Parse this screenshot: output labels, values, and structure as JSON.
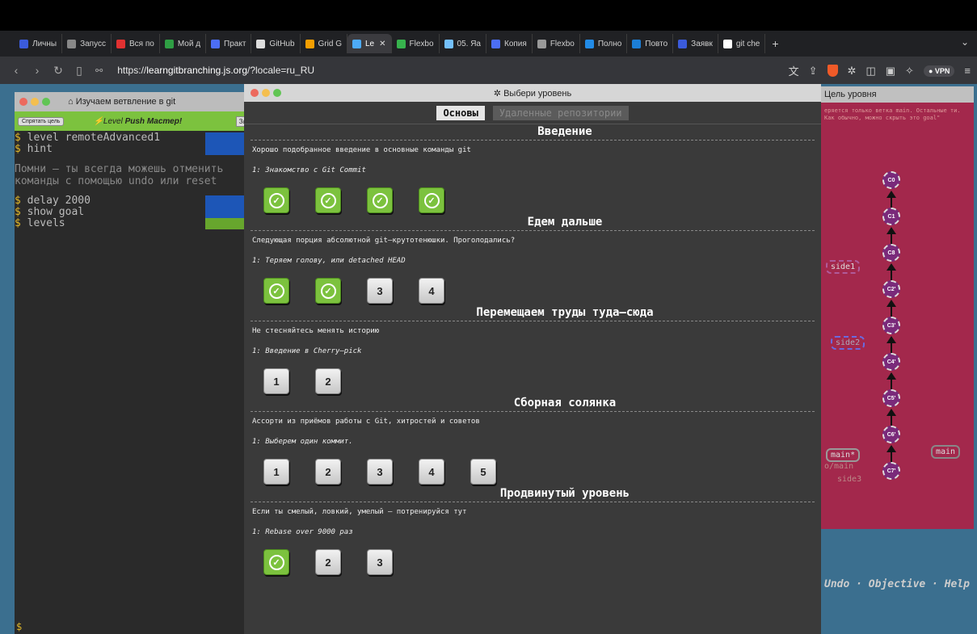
{
  "browser": {
    "tabs": [
      {
        "label": "Личны",
        "color": "#3b5bdb"
      },
      {
        "label": "Запусс",
        "color": "#888888"
      },
      {
        "label": "Вся по",
        "color": "#e03131"
      },
      {
        "label": "Мой д",
        "color": "#2f9e44"
      },
      {
        "label": "Практ",
        "color": "#4c6ef5"
      },
      {
        "label": "GitHub",
        "color": "#dddddd"
      },
      {
        "label": "Grid G",
        "color": "#f59f00"
      },
      {
        "label": "Le",
        "color": "#4dabf7",
        "active": true
      },
      {
        "label": "Flexbo",
        "color": "#37b24d"
      },
      {
        "label": "05. Яа",
        "color": "#74c0fc"
      },
      {
        "label": "Копия",
        "color": "#4c6ef5"
      },
      {
        "label": "Flexbo",
        "color": "#999999"
      },
      {
        "label": "Полно",
        "color": "#228be6"
      },
      {
        "label": "Повто",
        "color": "#1c7ed6"
      },
      {
        "label": "Заявк",
        "color": "#3b5bdb"
      },
      {
        "label": "git che",
        "color": "#ffffff"
      }
    ],
    "url_prefix": "https://",
    "url_host": "learngitbranching.js.org",
    "url_path": "/?locale=ru_RU",
    "vpn_label": "VPN"
  },
  "terminal": {
    "title": "Изучаем ветвление в git",
    "hide_goal": "Спрятать цель",
    "level_label": "Level",
    "level_name": "Push Мастер!",
    "task_label": "Зада",
    "lines": [
      "level remoteAdvanced1",
      "hint"
    ],
    "hint": "Помни – ты всегда можешь отменить команды с помощью undo или reset",
    "lines2": [
      "delay 2000",
      "show goal",
      "levels"
    ],
    "prompt": "$"
  },
  "goal": {
    "title": "Цель уровня",
    "desc": "еряется только ветка main. Остальные ти. Как обычно, можно скрыть это goal\"",
    "commits": [
      "C0",
      "C1",
      "C8",
      "C2'",
      "C3'",
      "C4'",
      "C5'",
      "C6'",
      "C7'"
    ],
    "branches": {
      "side1": "side1",
      "side2": "side2",
      "main_star": "main*",
      "o_main": "o/main",
      "side3": "side3",
      "main": "main"
    }
  },
  "undo_line": "Undo · Objective · Help",
  "modal": {
    "title": "Выбери уровень",
    "tabs": [
      "Основы",
      "Удаленные репозитории"
    ],
    "sections": [
      {
        "head": "Введение",
        "desc": "Хорошо подобранное введение в основные команды git",
        "sub": "1: Знакомство с Git Commit",
        "levels": [
          {
            "n": "1",
            "done": true
          },
          {
            "n": "2",
            "done": true
          },
          {
            "n": "3",
            "done": true
          },
          {
            "n": "4",
            "done": true
          }
        ]
      },
      {
        "head": "Едем дальше",
        "desc": "Следующая порция абсолютной git–крутотенюшки. Проголодались?",
        "sub": "1: Теряем голову, или detached HEAD",
        "levels": [
          {
            "n": "1",
            "done": true
          },
          {
            "n": "2",
            "done": true
          },
          {
            "n": "3",
            "done": false
          },
          {
            "n": "4",
            "done": false
          }
        ]
      },
      {
        "head": "Перемещаем труды туда–сюда",
        "desc": "Не стесняйтесь менять историю",
        "sub": "1: Введение в Cherry–pick",
        "levels": [
          {
            "n": "1",
            "done": false
          },
          {
            "n": "2",
            "done": false
          }
        ]
      },
      {
        "head": "Сборная солянка",
        "desc": "Ассорти из приёмов работы с Git, хитростей и советов",
        "sub": "1: Выберем один коммит.",
        "levels": [
          {
            "n": "1",
            "done": false
          },
          {
            "n": "2",
            "done": false
          },
          {
            "n": "3",
            "done": false
          },
          {
            "n": "4",
            "done": false
          },
          {
            "n": "5",
            "done": false
          }
        ]
      },
      {
        "head": "Продвинутый уровень",
        "desc": "Если ты смелый, ловкий, умелый – потренируйся тут",
        "sub": "1: Rebase over 9000 раз",
        "levels": [
          {
            "n": "1",
            "done": true
          },
          {
            "n": "2",
            "done": false
          },
          {
            "n": "3",
            "done": false
          }
        ]
      }
    ]
  },
  "colors": {
    "done": "#7cc23e",
    "goal_bg": "#a3284c",
    "page_bg": "#3b6f8f"
  }
}
